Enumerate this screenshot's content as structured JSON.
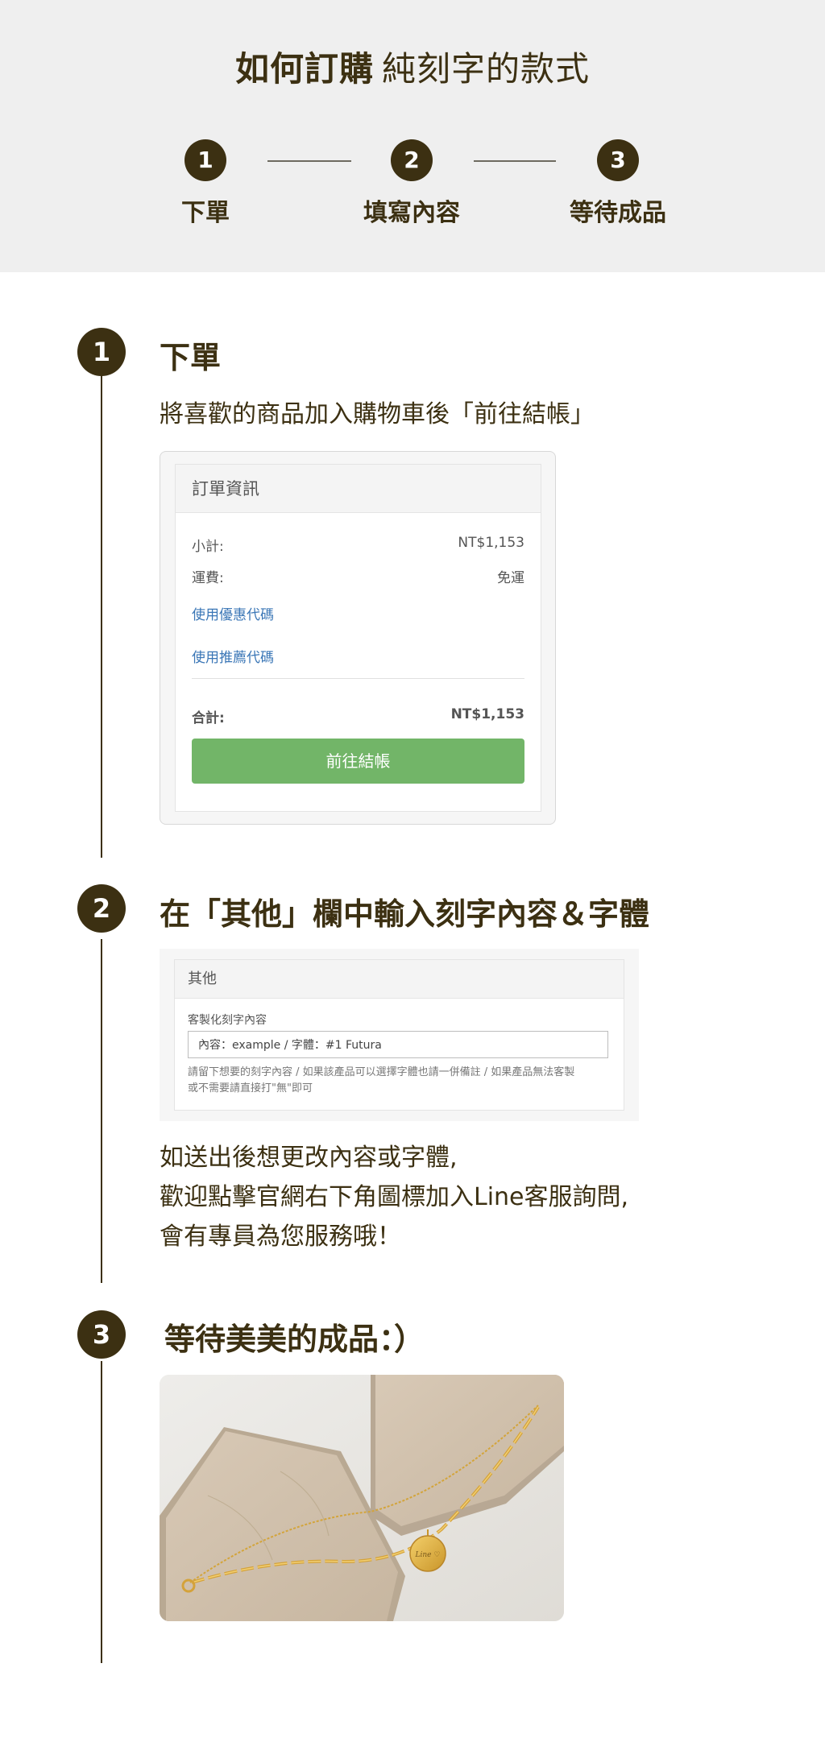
{
  "header": {
    "title_strong": "如何訂購",
    "title_light": "純刻字的款式",
    "steps": [
      {
        "number": "1",
        "label": "下單"
      },
      {
        "number": "2",
        "label": "填寫內容"
      },
      {
        "number": "3",
        "label": "等待成品"
      }
    ]
  },
  "section1": {
    "number": "1",
    "title": "下單",
    "description": "將喜歡的商品加入購物車後「前往結帳」",
    "order": {
      "heading": "訂單資訊",
      "subtotal_label": "小計:",
      "subtotal_value": "NT$1,153",
      "shipping_label": "運費:",
      "shipping_value": "免運",
      "coupon_link": "使用優惠代碼",
      "referral_link": "使用推薦代碼",
      "total_label": "合計:",
      "total_value": "NT$1,153",
      "checkout_button": "前往結帳"
    }
  },
  "section2": {
    "number": "2",
    "title": "在「其他」欄中輸入刻字內容＆字體",
    "form": {
      "heading": "其他",
      "field_label": "客製化刻字內容",
      "field_value": "內容：example / 字體：#1 Futura",
      "help_line1": "請留下想要的刻字內容 / 如果該產品可以選擇字體也請一併備註 / 如果產品無法客製",
      "help_line2": "或不需要請直接打\"無\"即可"
    },
    "note_line1": "如送出後想更改內容或字體,",
    "note_line2": "歡迎點擊官網右下角圖標加入Line客服詢問,",
    "note_line3": "會有專員為您服務哦！"
  },
  "section3": {
    "number": "3",
    "title": "等待美美的成品：）",
    "pendant_engraving": "Line ♡"
  },
  "colors": {
    "brand_dark": "#3c3012",
    "header_bg": "#efefef",
    "checkout_green": "#72b568",
    "link_blue": "#3a76b6"
  }
}
